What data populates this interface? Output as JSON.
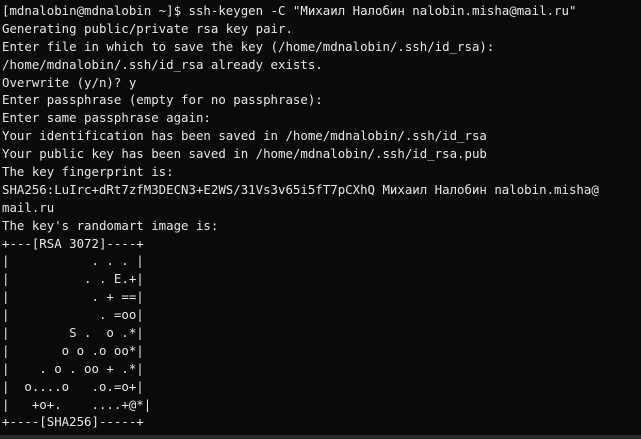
{
  "terminal": {
    "lines": [
      "[mdnalobin@mdnalobin ~]$ ssh-keygen -C \"Михаил Налобин nalobin.misha@mail.ru\"",
      "Generating public/private rsa key pair.",
      "Enter file in which to save the key (/home/mdnalobin/.ssh/id_rsa):",
      "/home/mdnalobin/.ssh/id_rsa already exists.",
      "Overwrite (y/n)? y",
      "Enter passphrase (empty for no passphrase):",
      "Enter same passphrase again:",
      "Your identification has been saved in /home/mdnalobin/.ssh/id_rsa",
      "Your public key has been saved in /home/mdnalobin/.ssh/id_rsa.pub",
      "The key fingerprint is:",
      "SHA256:LuIrc+dRt7zfM3DECN3+E2WS/31Vs3v65i5fT7pCXhQ Михаил Налобин nalobin.misha@",
      "mail.ru",
      "The key's randomart image is:",
      "+---[RSA 3072]----+",
      "|           . . . |",
      "|          . . E.+|",
      "|           . + ==|",
      "|            . =oo|",
      "|        S .  o .*|",
      "|       o o .o oo*|",
      "|    . o . oo + .*|",
      "|  o....o   .o.=o+|",
      "|   +o+.    ....+@*|",
      "+----[SHA256]-----+"
    ]
  },
  "colors": {
    "background": "#0a0a0a",
    "text": "#e6e6e6"
  }
}
